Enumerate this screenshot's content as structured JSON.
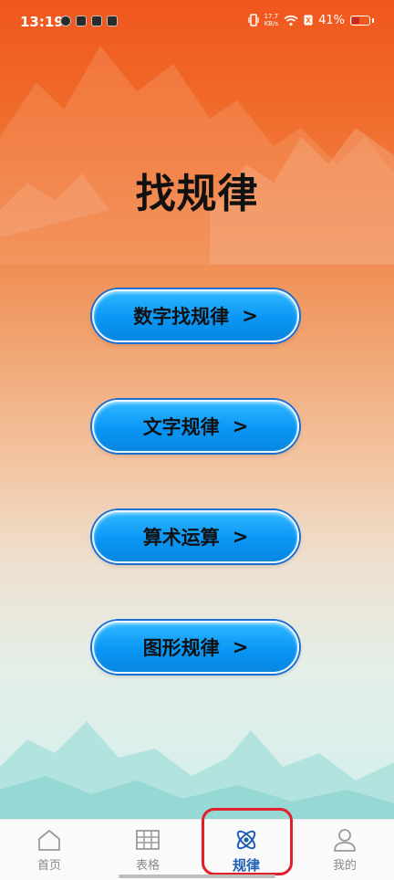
{
  "status_bar": {
    "time": "13:19",
    "net_speed_value": "17.7",
    "net_speed_unit": "KB/s",
    "battery_percent": "41%",
    "battery_level": 0.41
  },
  "page": {
    "title": "找规律"
  },
  "menu": [
    {
      "label": "数字找规律",
      "arrow": ">"
    },
    {
      "label": "文字规律",
      "arrow": ">"
    },
    {
      "label": "算术运算",
      "arrow": ">"
    },
    {
      "label": "图形规律",
      "arrow": ">"
    }
  ],
  "bottom_nav": [
    {
      "label": "首页",
      "icon": "home-icon",
      "active": false
    },
    {
      "label": "表格",
      "icon": "grid-icon",
      "active": false
    },
    {
      "label": "规律",
      "icon": "atom-icon",
      "active": true
    },
    {
      "label": "我的",
      "icon": "user-icon",
      "active": false
    }
  ],
  "colors": {
    "accent": "#1d5fb3",
    "button": "#0a96f5",
    "highlight": "#e21e2a"
  }
}
